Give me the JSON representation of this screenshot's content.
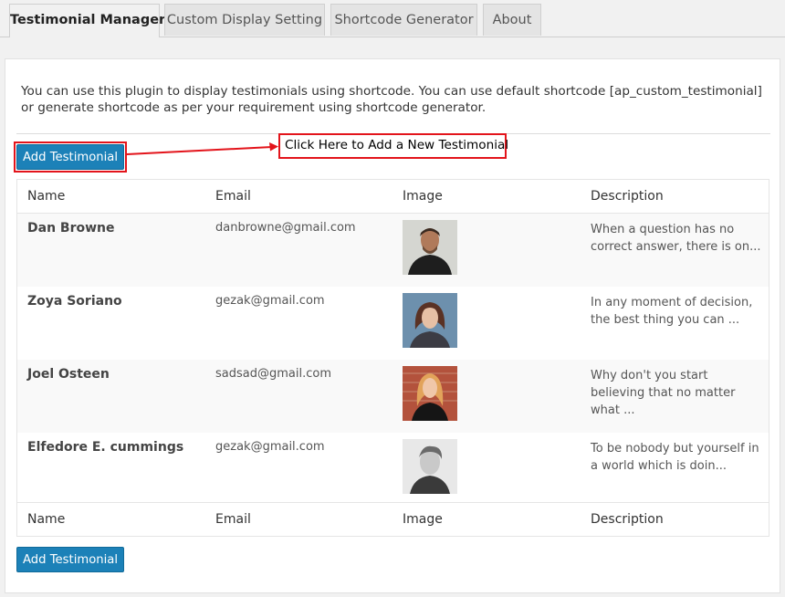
{
  "tabs": [
    {
      "label": "Testimonial Manager"
    },
    {
      "label": "Custom Display Setting"
    },
    {
      "label": "Shortcode Generator"
    },
    {
      "label": "About"
    }
  ],
  "intro": {
    "line1": "You can use this plugin to display testimonials using shortcode. You can use default shortcode  [ap_custom_testimonial]",
    "line2": "or generate shortcode as per your requirement using shortcode generator."
  },
  "buttons": {
    "add_top": "Add Testimonial",
    "add_bottom": "Add Testimonial"
  },
  "annotation": {
    "callout_text": "Click Here to Add a New Testimonial",
    "color": "#e3141b"
  },
  "table": {
    "headers": [
      "Name",
      "Email",
      "Image",
      "Description"
    ],
    "footers": [
      "Name",
      "Email",
      "Image",
      "Description"
    ],
    "rows": [
      {
        "name": "Dan Browne",
        "email": "danbrowne@gmail.com",
        "image": "avatar-man-dark-bg",
        "description": "When a question has no correct answer, there is on..."
      },
      {
        "name": "Zoya Soriano",
        "email": "gezak@gmail.com",
        "image": "avatar-woman-blue-bg",
        "description": "In any moment of decision, the best thing you can ..."
      },
      {
        "name": "Joel Osteen",
        "email": "sadsad@gmail.com",
        "image": "avatar-woman-brick-bg",
        "description": "Why don't you start believing that no matter what ..."
      },
      {
        "name": "Elfedore E. cummings",
        "email": "gezak@gmail.com",
        "image": "avatar-man-bw",
        "description": "To be nobody but yourself in a world which is doin..."
      }
    ]
  },
  "colors": {
    "primary_button": "#1c81b8",
    "annotation_red": "#e3141b"
  }
}
